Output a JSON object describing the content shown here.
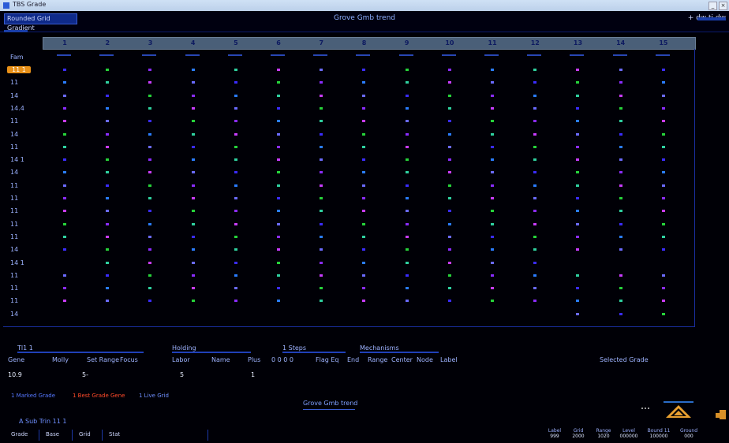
{
  "window": {
    "title": "TBS Grade"
  },
  "topbar": {
    "menu_label": "Rounded Grid Gradient",
    "center_title": "Grove Gmb trend",
    "right_label": "+ dw ti dw"
  },
  "columns": [
    "1",
    "2",
    "3",
    "4",
    "5",
    "6",
    "7",
    "8",
    "9",
    "10",
    "11",
    "12",
    "13",
    "14",
    "15"
  ],
  "rows": [
    {
      "label": "11 1",
      "selected": true
    },
    {
      "label": "11"
    },
    {
      "label": "14"
    },
    {
      "label": "14.4"
    },
    {
      "label": "11"
    },
    {
      "label": "14"
    },
    {
      "label": "11"
    },
    {
      "label": "14 1"
    },
    {
      "label": "14"
    },
    {
      "label": "11"
    },
    {
      "label": "11"
    },
    {
      "label": "11"
    },
    {
      "label": "11"
    },
    {
      "label": "11"
    },
    {
      "label": "14"
    },
    {
      "label": "14 1"
    },
    {
      "label": "11"
    },
    {
      "label": "11"
    },
    {
      "label": "11"
    },
    {
      "label": "14"
    }
  ],
  "first_row_label": "Fam",
  "info": {
    "section_left": "Tl1 1",
    "section_mid": "Holding",
    "section_steps": "1 Steps",
    "section_mech": "Mechanisms",
    "fields": [
      "Gene",
      "Molly",
      "Set Range",
      "Focus",
      "Labor",
      "Name",
      "Plus",
      "0 0 0 0",
      "Flag Eq",
      "End",
      "Range",
      "Center",
      "Node",
      "Label"
    ],
    "right_field": "Selected Grade",
    "values": [
      "10.9",
      "5-",
      "5",
      "1"
    ]
  },
  "legend": [
    {
      "text": "1 Marked Grade",
      "color": "#5577ff"
    },
    {
      "text": "1 Best Grade Gene",
      "color": "#ff4a2a"
    },
    {
      "text": "1 Live Grid",
      "color": "#6f8fff"
    }
  ],
  "footer": {
    "title": "Grove Gmb trend",
    "breadcrumb": "A Sub Trin 11 1",
    "tabs": [
      "Grade",
      "Base",
      "Grid",
      "Stat"
    ],
    "stats": [
      {
        "label": "Label",
        "value": "999"
      },
      {
        "label": "Grid",
        "value": "2000"
      },
      {
        "label": "Range",
        "value": "1020"
      },
      {
        "label": "Level",
        "value": "000000"
      },
      {
        "label": "Bound 11",
        "value": "100000"
      },
      {
        "label": "Ground",
        "value": "000"
      }
    ]
  },
  "colors": {
    "accent": "#e89018",
    "grid_line": "#1a2ea0",
    "header": "#4a5f78"
  }
}
